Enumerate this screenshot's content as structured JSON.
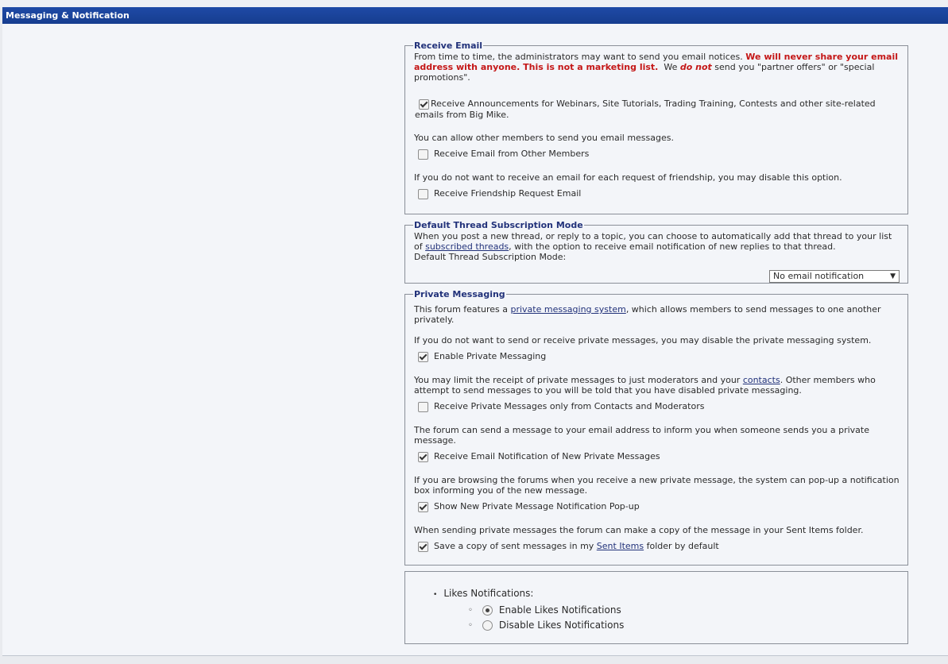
{
  "window": {
    "title": "Messaging & Notification"
  },
  "receive_email": {
    "legend": "Receive Email",
    "intro_plain": "From time to time, the administrators may want to send you email notices.",
    "intro_bold": "We will never share your email address with anyone. This is not a marketing list.",
    "intro_we": "We",
    "intro_donot": "do not",
    "intro_rest": "send you \"partner offers\" or \"special promotions\".",
    "announcements_label": "Receive Announcements for Webinars, Site Tutorials, Trading Training, Contests and other site-related emails from Big Mike.",
    "announcements_checked": true,
    "members_text": "You can allow other members to send you email messages.",
    "members_label": "Receive Email from Other Members",
    "members_checked": false,
    "friendship_text": "If you do not want to receive an email for each request of friendship, you may disable this option.",
    "friendship_label": "Receive Friendship Request Email",
    "friendship_checked": false
  },
  "thread_subscription": {
    "legend": "Default Thread Subscription Mode",
    "text_part1": "When you post a new thread, or reply to a topic, you can choose to automatically add that thread to your list of",
    "link": "subscribed threads",
    "text_part2": ", with the option to receive email notification of new replies to that thread.",
    "mode_label": "Default Thread Subscription Mode:",
    "mode_value": "No email notification",
    "arrow": "▼"
  },
  "private_messaging": {
    "legend": "Private Messaging",
    "intro_part1": "This forum features a",
    "intro_link": "private messaging system",
    "intro_part2": ", which allows members to send messages to one another privately.",
    "disable_text": "If you do not want to send or receive private messages, you may disable the private messaging system.",
    "enable_label": "Enable Private Messaging",
    "enable_checked": true,
    "limit_part1": "You may limit the receipt of private messages to just moderators and your",
    "limit_link": "contacts",
    "limit_part2": ". Other members who attempt to send messages to you will be told that you have disabled private messaging.",
    "contacts_only_label": "Receive Private Messages only from Contacts and Moderators",
    "contacts_only_checked": false,
    "email_notify_text": "The forum can send a message to your email address to inform you when someone sends you a private message.",
    "email_notify_label": "Receive Email Notification of New Private Messages",
    "email_notify_checked": true,
    "popup_text": "If you are browsing the forums when you receive a new private message, the system can pop-up a notification box informing you of the new message.",
    "popup_label": "Show New Private Message Notification Pop-up",
    "popup_checked": true,
    "sent_text": "When sending private messages the forum can make a copy of the message in your Sent Items folder.",
    "sent_part1": "Save a copy of sent messages in my",
    "sent_link": "Sent Items",
    "sent_part2": "folder by default",
    "sent_checked": true
  },
  "likes": {
    "heading": "Likes Notifications:",
    "enable_label": "Enable Likes Notifications",
    "disable_label": "Disable Likes Notifications",
    "selected": "enable"
  }
}
